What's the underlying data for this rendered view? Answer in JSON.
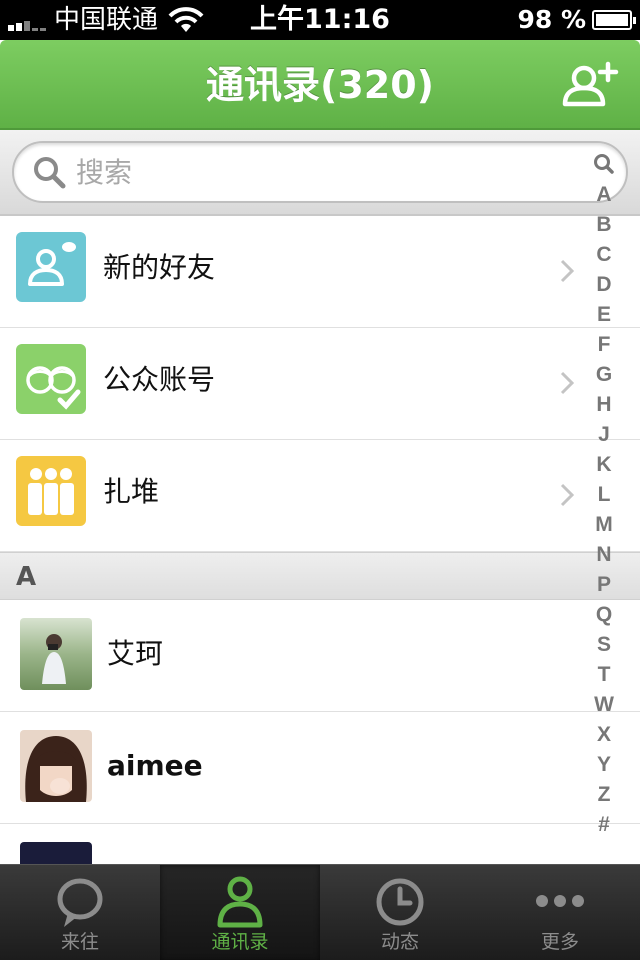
{
  "status_bar": {
    "carrier": "中国联通",
    "time": "上午11:16",
    "battery": "98 %"
  },
  "nav": {
    "title": "通讯录(320)",
    "add_icon": "add-contact-icon"
  },
  "search": {
    "placeholder": "搜索",
    "icon": "search-icon"
  },
  "features": [
    {
      "label": "新的好友",
      "icon": "new-friend-icon",
      "color": "#6cc7d4"
    },
    {
      "label": "公众账号",
      "icon": "official-accounts-icon",
      "color": "#8bd16a"
    },
    {
      "label": "扎堆",
      "icon": "group-icon",
      "color": "#f5c842"
    }
  ],
  "sections": [
    {
      "letter": "A",
      "contacts": [
        {
          "name": "艾珂",
          "avatar": "photo-avatar"
        },
        {
          "name": "aimee",
          "avatar": "photo-avatar"
        }
      ]
    }
  ],
  "index_letters": [
    "A",
    "B",
    "C",
    "D",
    "E",
    "F",
    "G",
    "H",
    "J",
    "K",
    "L",
    "M",
    "N",
    "P",
    "Q",
    "S",
    "T",
    "W",
    "X",
    "Y",
    "Z",
    "#"
  ],
  "tabs": [
    {
      "label": "来往",
      "icon": "chat-bubble-icon",
      "active": false
    },
    {
      "label": "通讯录",
      "icon": "contacts-icon",
      "active": true
    },
    {
      "label": "动态",
      "icon": "clock-icon",
      "active": false
    },
    {
      "label": "更多",
      "icon": "more-icon",
      "active": false
    }
  ],
  "colors": {
    "accent": "#5fb146",
    "nav_bar": "#6cbf52"
  }
}
